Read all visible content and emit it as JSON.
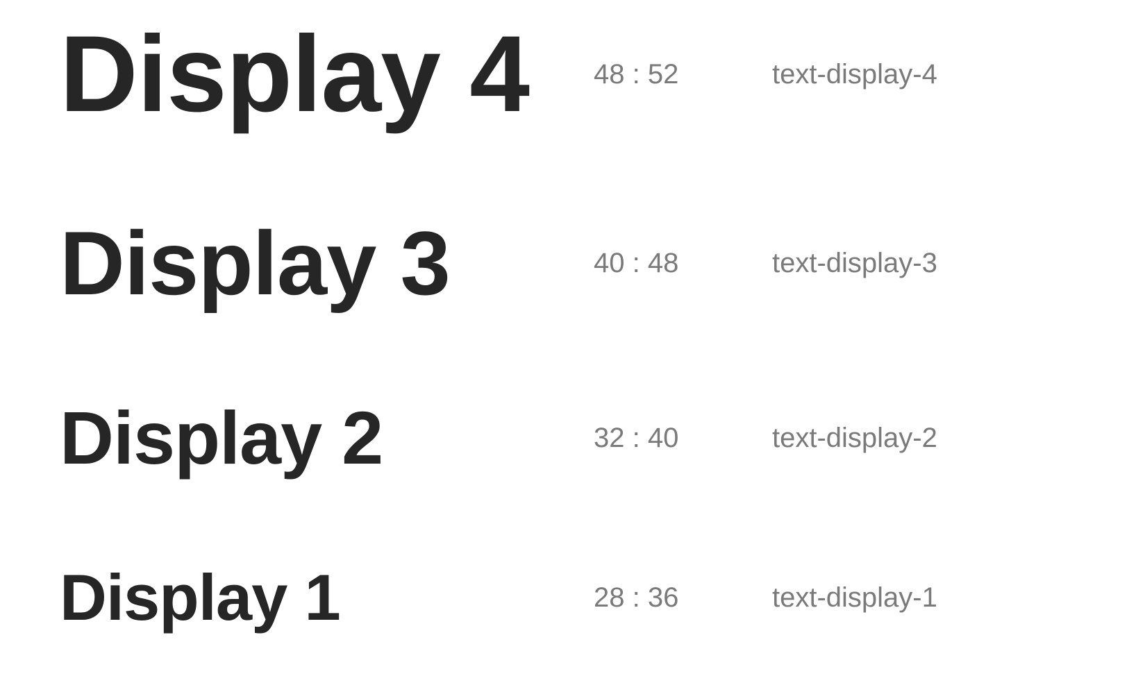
{
  "type_scale": [
    {
      "sample": "Display 4",
      "metrics": "48 : 52",
      "token": "text-display-4"
    },
    {
      "sample": "Display 3",
      "metrics": "40 : 48",
      "token": "text-display-3"
    },
    {
      "sample": "Display 2",
      "metrics": "32 : 40",
      "token": "text-display-2"
    },
    {
      "sample": "Display 1",
      "metrics": "28 : 36",
      "token": "text-display-1"
    }
  ],
  "colors": {
    "sample_text": "#262626",
    "meta_text": "#7a7a7a",
    "background": "#ffffff"
  }
}
